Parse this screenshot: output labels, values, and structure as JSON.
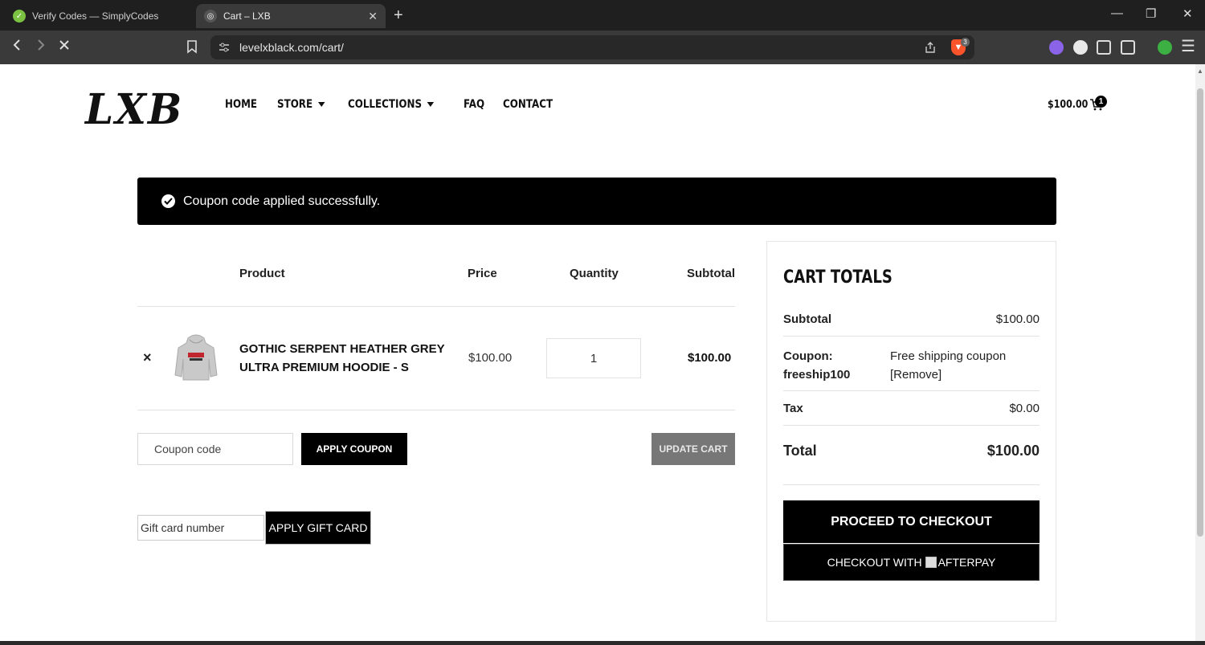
{
  "browser": {
    "tabs": [
      {
        "title": "Verify Codes — SimplyCodes",
        "active": false
      },
      {
        "title": "Cart – LXB",
        "active": true
      }
    ],
    "new_tab": "+",
    "url": "levelxblack.com/cart/",
    "brave_shields_count": "3",
    "window_controls": {
      "minimize": "—",
      "restore": "❐",
      "close": "✕"
    },
    "icons": {
      "back": "chevron-left-icon",
      "forward": "chevron-right-icon",
      "stop": "close-icon",
      "bookmark": "bookmark-icon"
    }
  },
  "site": {
    "logo": "LXB",
    "nav": [
      {
        "label": "HOME",
        "dropdown": false
      },
      {
        "label": "STORE",
        "dropdown": true
      },
      {
        "label": "COLLECTIONS",
        "dropdown": true
      },
      {
        "label": "FAQ",
        "dropdown": false
      },
      {
        "label": "CONTACT",
        "dropdown": false
      }
    ],
    "cart_amount": "$100.00",
    "cart_count": "1"
  },
  "notice": {
    "message": "Coupon code applied successfully."
  },
  "cart": {
    "headers": {
      "product": "Product",
      "price": "Price",
      "quantity": "Quantity",
      "subtotal": "Subtotal"
    },
    "items": [
      {
        "remove": "×",
        "name_line1": "GOTHIC SERPENT HEATHER GREY",
        "name_line2": "ULTRA PREMIUM HOODIE - S",
        "price": "$100.00",
        "quantity": "1",
        "subtotal": "$100.00"
      }
    ],
    "coupon_placeholder": "Coupon code",
    "apply_coupon": "APPLY COUPON",
    "update_cart": "UPDATE CART",
    "gift_placeholder": "Gift card number",
    "apply_gift": "APPLY GIFT CARD"
  },
  "totals": {
    "title": "CART TOTALS",
    "subtotal_label": "Subtotal",
    "subtotal_value": "$100.00",
    "coupon_label_1": "Coupon:",
    "coupon_label_2": "freeship100",
    "coupon_value": "Free shipping coupon",
    "coupon_remove": "[Remove]",
    "tax_label": "Tax",
    "tax_value": "$0.00",
    "total_label": "Total",
    "total_value": "$100.00",
    "checkout": "PROCEED TO CHECKOUT",
    "afterpay_prefix": "CHECKOUT WITH",
    "afterpay_alt": "AFTERPAY"
  },
  "colors": {
    "accent": "#000000",
    "notice_bg": "#000000",
    "update_btn": "#777777",
    "brave": "#fb542b"
  }
}
